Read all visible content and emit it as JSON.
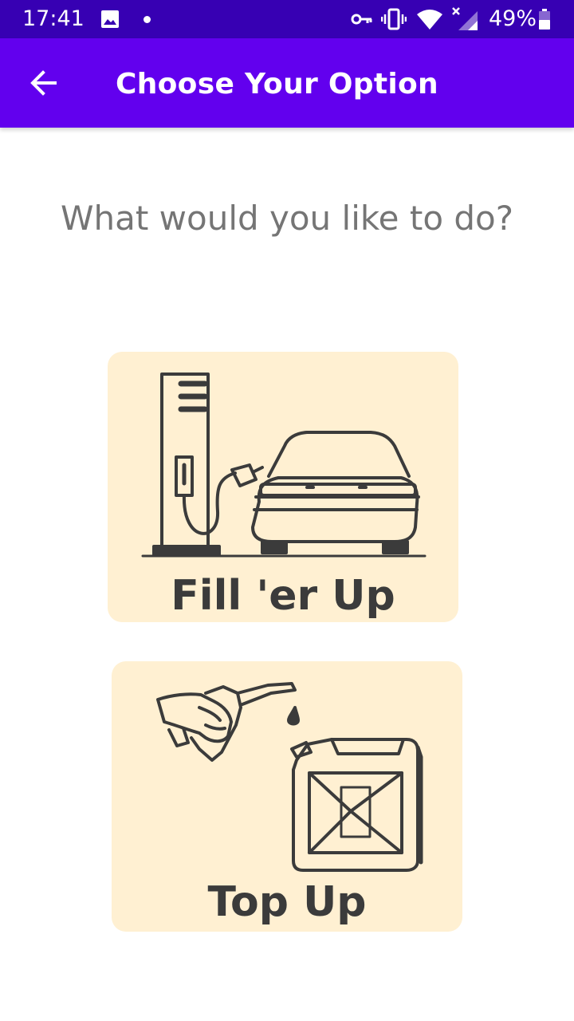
{
  "status_bar": {
    "time": "17:41",
    "battery": "49%",
    "icons": [
      "gallery-icon",
      "notification-dot-icon",
      "vpn-key-icon",
      "vibrate-icon",
      "wifi-icon",
      "signal-icon",
      "battery-icon"
    ]
  },
  "app_bar": {
    "title": "Choose Your Option",
    "back_icon": "arrow-back-icon",
    "color": "#6200ee",
    "status_color": "#3700b3"
  },
  "main": {
    "question": "What would you like to do?",
    "options": [
      {
        "label": "Fill 'er Up",
        "icon": "fuel-pump-car-icon"
      },
      {
        "label": "Top Up",
        "icon": "fuel-nozzle-jerrycan-icon"
      }
    ],
    "card_color": "#fff0d2"
  }
}
